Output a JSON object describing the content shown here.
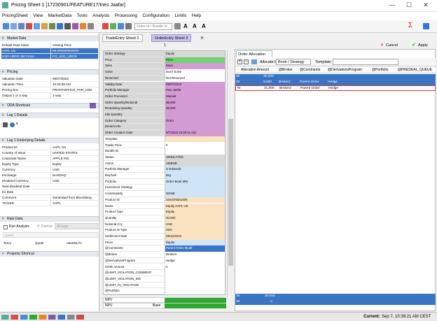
{
  "window": {
    "title": "Pricing Sheet 1 [17230901/FEATURE17/Ines Jaafar]"
  },
  "menu": [
    "PricingSheet",
    "View",
    "MarketData",
    "Tools",
    "Analysis",
    "Processing",
    "Configuration",
    "Limits",
    "Help"
  ],
  "toolbar": {
    "search_placeholder": "Order Id / Bundle Id"
  },
  "left": {
    "market_data": {
      "title": "Market Data",
      "rows": [
        {
          "k": "Default Rate Sides",
          "v": "Closing Price"
        },
        {
          "k": "AAPL US",
          "v": "58.000000000000"
        },
        {
          "k": "USD LIBOR 3M Curve",
          "v": "FO_USD_LIBOR"
        }
      ]
    },
    "pricing": {
      "title": "Pricing",
      "rows": [
        {
          "k": "Valuation Date",
          "v": "09/07/2023"
        },
        {
          "k": "Valuation Time",
          "v": "10:25:38 AM"
        },
        {
          "k": "Pricing Env",
          "v": "FRONTOFFICE_PAR_USD"
        },
        {
          "k": "Output 1 or 2 way",
          "v": "1-way"
        }
      ]
    },
    "oda": {
      "title": "ODA Shortcuts"
    },
    "leg1_details": {
      "title": "Leg 1 Details"
    },
    "leg1_underlying": {
      "title": "Leg 1 Underlying Details",
      "rows": [
        {
          "k": "Product ID",
          "v": "AAPL US"
        },
        {
          "k": "Country of Issue",
          "v": "UNITED STATES"
        },
        {
          "k": "Corporate Name",
          "v": "APPLE INC"
        },
        {
          "k": "Equity Type",
          "v": "Equity"
        },
        {
          "k": "Currency",
          "v": "USD"
        },
        {
          "k": "Exchange",
          "v": "NASDAQ"
        },
        {
          "k": "Dividend Currency",
          "v": "USD"
        },
        {
          "k": "Next Dividend Date",
          "v": ""
        },
        {
          "k": "Ex Date",
          "v": ""
        },
        {
          "k": "Comment",
          "v": "Generated from Bloomberg"
        },
        {
          "k": "TICKER",
          "v": "AAPL"
        }
      ]
    },
    "rate_data": {
      "title": "Rate Data",
      "run_analysis": "Run Analysis",
      "cancel": "Cancel",
      "all_legs": "All legs",
      "curve": "Curve",
      "tenor": "Tenor",
      "quote": "Quote",
      "rate_delta": "rateDELTA"
    },
    "property_shortcut": {
      "title": "Property Shortcut"
    }
  },
  "tabs": {
    "tab1": "TradeEntry Sheet 1",
    "tab2": "OrderEntry Sheet 2",
    "field_value": "1"
  },
  "grid": [
    {
      "k": "Order Strategy",
      "v": "Equity",
      "c": "#d8d8d8"
    },
    {
      "k": "Price",
      "v": "Price",
      "c": "#6fd36f"
    },
    {
      "k": "Save",
      "v": "Save",
      "c": "#d49ad4"
    },
    {
      "k": "Solve",
      "v": "Don't Solve",
      "c": "#fff"
    },
    {
      "k": "Reserved",
      "v": "Not Reserved",
      "c": "#fff"
    },
    {
      "k": "Validity Date",
      "v": "09/07/2023",
      "c": "#d49ad4"
    },
    {
      "k": "Portfolio Manager",
      "v": "Ines Jaafar",
      "c": "#d49ad4"
    },
    {
      "k": "Order Processor",
      "v": "Manual",
      "c": "#d49ad4"
    },
    {
      "k": "Order Quantity/Notional",
      "v": "30,000",
      "c": "#d49ad4"
    },
    {
      "k": "Remaining Quantity",
      "v": "30,000",
      "c": "#d49ad4"
    },
    {
      "k": "Idle Quantity",
      "v": "",
      "c": "#d49ad4"
    },
    {
      "k": "Order Category",
      "v": "Order",
      "c": "#d49ad4"
    },
    {
      "k": "Breach Info",
      "v": "",
      "c": "#d49ad4"
    },
    {
      "k": "Order Creation Date",
      "v": "9/7/2023 10:20:11 AM",
      "c": "#d49ad4"
    },
    {
      "k": "Template",
      "v": "",
      "c": "#fbe3c2"
    },
    {
      "k": "Trader Price",
      "v": "0",
      "c": "#fff"
    },
    {
      "k": "Bundle ID",
      "v": "",
      "c": "#fff"
    },
    {
      "k": "Status",
      "v": "SIMULATED",
      "c": "#d8d8d8"
    },
    {
      "k": "Action",
      "v": "AMEND",
      "c": "#d8d8d8"
    },
    {
      "k": "Portfolio Manager",
      "v": "O Edwards",
      "c": "#d0e4f7"
    },
    {
      "k": "Buy/Sell",
      "v": "Buy",
      "c": "#d0e4f7"
    },
    {
      "k": "Portfolio",
      "v": "Order Book MM",
      "c": "#d0e4f7"
    },
    {
      "k": "Investment Strategy",
      "v": "",
      "c": "#d0e4f7"
    },
    {
      "k": "Counterparty",
      "v": "NONE",
      "c": "#d0e4f7"
    },
    {
      "k": "Product ID",
      "v": "US0378331005",
      "c": "#fbe3c2"
    },
    {
      "k": "Name",
      "v": "Equity AAPL US",
      "c": "#fbe3c2"
    },
    {
      "k": "Product Type",
      "v": "Equity",
      "c": "#fbe3c2"
    },
    {
      "k": "Quantity",
      "v": "30,000",
      "c": "#fbe3c2"
    },
    {
      "k": "Notional Ccy",
      "v": "USD",
      "c": "#fbe3c2"
    },
    {
      "k": "Product ID Type",
      "v": "ISIN",
      "c": "#fbe3c2"
    },
    {
      "k": "Settlement Date",
      "v": "09/12/2023",
      "c": "#fbe3c2"
    },
    {
      "k": "Pricer",
      "v": "Equity",
      "c": "#d0e4f7"
    },
    {
      "k": "@Comments",
      "v": "Parent Order Modif",
      "c": "#3a74c5"
    },
    {
      "k": "@Broker",
      "v": "Broker2",
      "c": "#fff"
    },
    {
      "k": "@DerivativesProgram",
      "v": "Hedge",
      "c": "#fff"
    },
    {
      "k": "Settle Amount",
      "v": "0",
      "c": "#fff"
    },
    {
      "k": "@LIMIT_VIOLATION_COMMENT",
      "v": "",
      "c": "#fff"
    },
    {
      "k": "@LIMIT_VIOLATION_IDS",
      "v": "",
      "c": "#fff"
    },
    {
      "k": "@LIMIT_IN_VIOLATION",
      "v": "",
      "c": "#fff"
    },
    {
      "k": "@Portfolio",
      "v": "",
      "c": "#fff"
    }
  ],
  "npv": [
    {
      "k": "NPV",
      "v": "",
      "b": ""
    },
    {
      "k": "NPV",
      "v": "",
      "b": "Base"
    }
  ],
  "right": {
    "tab": "Order Allocation",
    "cancel": "Cancel",
    "apply": "Apply",
    "allocate_by_label": "Allocate by:",
    "allocate_by": "Book / Strategy",
    "template_label": "Template:",
    "columns": [
      "Allocation Amount",
      "@Broker",
      "@Comments",
      "@DerivativesProgram",
      "@Portfolio",
      "@PREDEAL_QUEUE"
    ],
    "rows": [
      {
        "n": "30",
        "amount": "30,000",
        "broker": "",
        "comments": "",
        "prog": "",
        "cls": "blue"
      },
      {
        "n": "30",
        "amount": "9,000",
        "broker": "Broker2",
        "comments": "Parent Order",
        "prog": "Hedge",
        "cls": "blue"
      },
      {
        "n": "70",
        "amount": "21,000",
        "broker": "Broker2",
        "comments": "Parent Order",
        "prog": "Hedge",
        "cls": "red"
      }
    ],
    "footer_rows": [
      {
        "n": "30",
        "amount": "30,000"
      },
      {
        "n": "30",
        "amount": "0"
      }
    ]
  },
  "status": {
    "current_label": "Current:",
    "current": "Sep 7, 10:38:21 AM CEST"
  }
}
